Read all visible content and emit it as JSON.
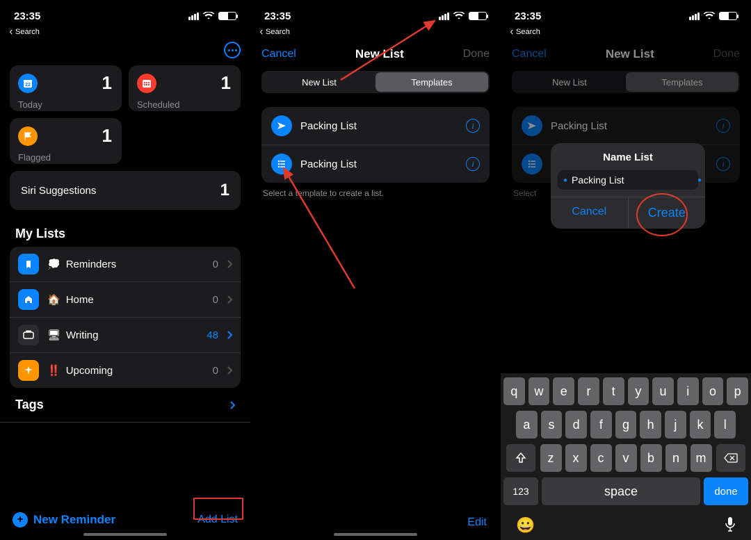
{
  "status": {
    "time": "23:35",
    "back": "Search"
  },
  "s1": {
    "cards": {
      "today": {
        "label": "Today",
        "count": "1"
      },
      "scheduled": {
        "label": "Scheduled",
        "count": "1"
      },
      "flagged": {
        "label": "Flagged",
        "count": "1"
      },
      "siri": {
        "label": "Siri Suggestions",
        "count": "1"
      }
    },
    "my_lists_header": "My Lists",
    "lists": [
      {
        "emoji": "💭",
        "name": "Reminders",
        "count": "0",
        "ic_bg": "#0a84ff",
        "ic_glyph": "bookmark",
        "chev": "#555"
      },
      {
        "emoji": "🏠",
        "name": "Home",
        "count": "0",
        "ic_bg": "#0a84ff",
        "ic_glyph": "home",
        "chev": "#555"
      },
      {
        "emoji": "🖥",
        "name": "Writing",
        "count": "48",
        "ic_bg": "#2c2c2e",
        "ic_glyph": "tv",
        "chev": "#0a84ff"
      },
      {
        "emoji": "‼️",
        "name": "Upcoming",
        "count": "0",
        "ic_bg": "#ff9500",
        "ic_glyph": "spark",
        "chev": "#555"
      }
    ],
    "tags_header": "Tags",
    "new_reminder": "New Reminder",
    "add_list": "Add List"
  },
  "s2": {
    "cancel": "Cancel",
    "title": "New List",
    "done": "Done",
    "seg_new": "New List",
    "seg_tmpl": "Templates",
    "templates": [
      {
        "name": "Packing List",
        "icon": "plane"
      },
      {
        "name": "Packing List",
        "icon": "list"
      }
    ],
    "hint": "Select a template to create a list.",
    "edit": "Edit"
  },
  "s3": {
    "cancel": "Cancel",
    "title": "New List",
    "done": "Done",
    "seg_new": "New List",
    "seg_tmpl": "Templates",
    "templates": [
      {
        "name": "Packing List",
        "icon": "plane"
      },
      {
        "name": "",
        "icon": "list"
      }
    ],
    "hint_prefix": "Select",
    "popover": {
      "title": "Name List",
      "value": "Packing List",
      "cancel": "Cancel",
      "create": "Create"
    },
    "keyboard": {
      "r1": [
        "q",
        "w",
        "e",
        "r",
        "t",
        "y",
        "u",
        "i",
        "o",
        "p"
      ],
      "r2": [
        "a",
        "s",
        "d",
        "f",
        "g",
        "h",
        "j",
        "k",
        "l"
      ],
      "r3": [
        "z",
        "x",
        "c",
        "v",
        "b",
        "n",
        "m"
      ],
      "num": "123",
      "space": "space",
      "done": "done"
    }
  }
}
